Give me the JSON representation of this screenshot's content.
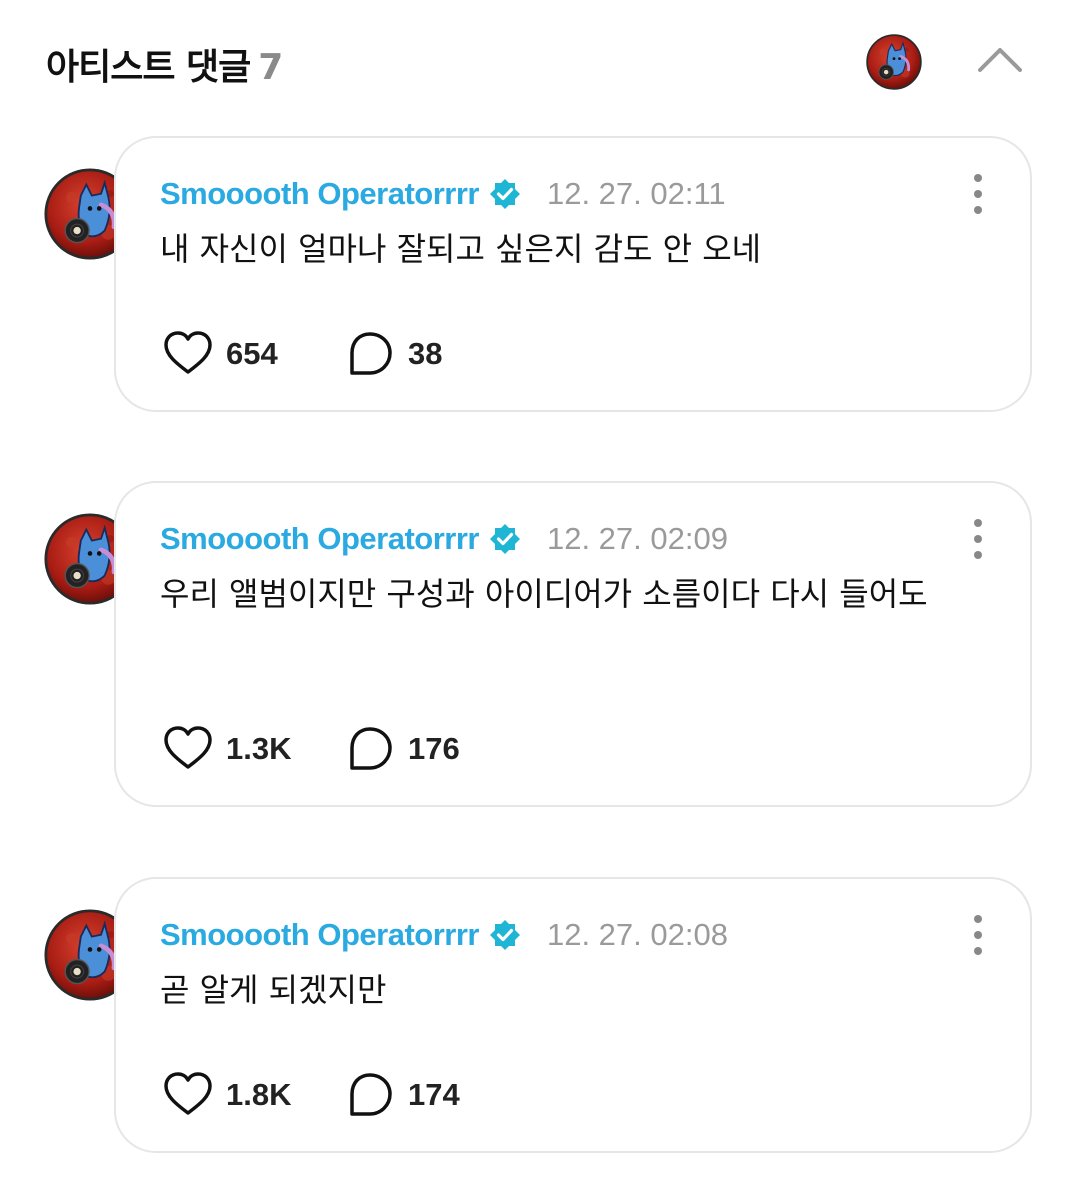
{
  "header": {
    "title": "아티스트 댓글",
    "count": "7"
  },
  "icons": {
    "avatar": "artist-avatar-icon",
    "collapse": "chevron-up-icon",
    "verified": "verified-badge-icon",
    "more": "more-vertical-icon",
    "like": "heart-icon",
    "reply": "comment-bubble-icon"
  },
  "colors": {
    "author": "#2aaae0",
    "verified": "#1fb5d4",
    "timestamp": "#9a9a9a",
    "avatar_bg": "#b8231a"
  },
  "comments": [
    {
      "author": "Smooooth Operatorrrr",
      "timestamp": "12. 27. 02:11",
      "text": "내 자신이 얼마나 잘되고 싶은지 감도 안 오네",
      "likes": "654",
      "replies": "38"
    },
    {
      "author": "Smooooth Operatorrrr",
      "timestamp": "12. 27. 02:09",
      "text": "우리 앨범이지만 구성과 아이디어가 소름이다 다시 들어도",
      "likes": "1.3K",
      "replies": "176"
    },
    {
      "author": "Smooooth Operatorrrr",
      "timestamp": "12. 27. 02:08",
      "text": "곧 알게 되겠지만",
      "likes": "1.8K",
      "replies": "174"
    }
  ]
}
